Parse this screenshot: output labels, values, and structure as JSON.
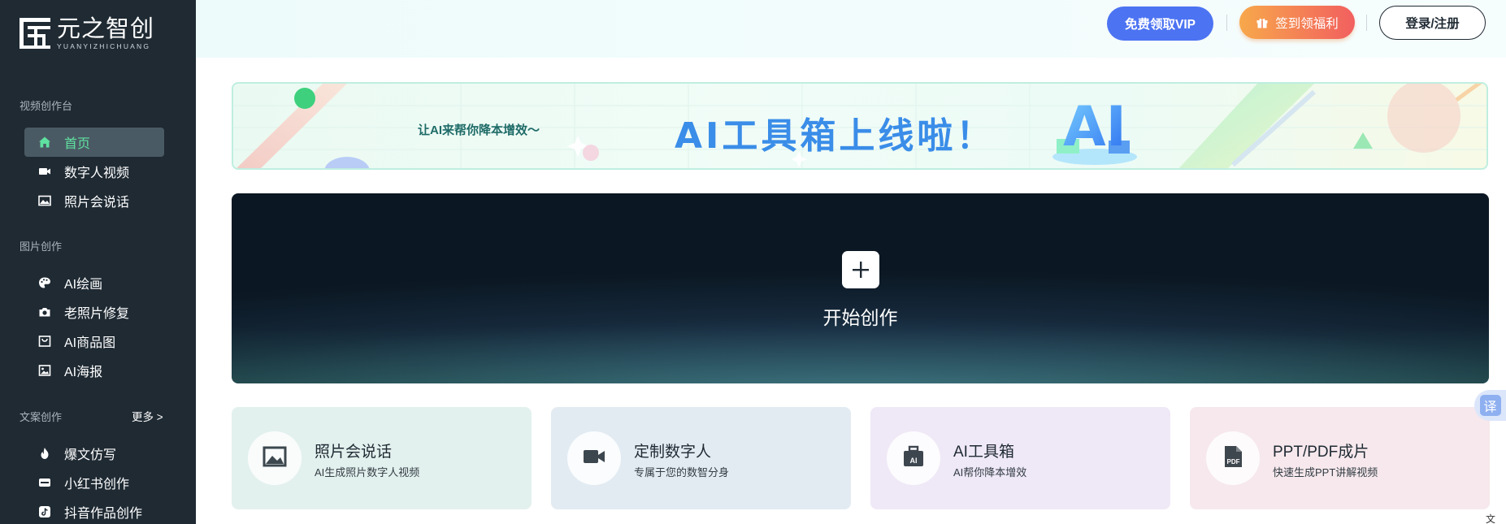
{
  "brand": {
    "name_cn": "元之智创",
    "name_en": "YUANYIZHICHUANG"
  },
  "sidebar": {
    "sections": [
      {
        "title": "视频创作台",
        "items": [
          {
            "label": "首页",
            "icon": "home-icon",
            "active": true
          },
          {
            "label": "数字人视频",
            "icon": "video-camera-icon"
          },
          {
            "label": "照片会说话",
            "icon": "image-icon"
          }
        ]
      },
      {
        "title": "图片创作",
        "items": [
          {
            "label": "AI绘画",
            "icon": "palette-icon"
          },
          {
            "label": "老照片修复",
            "icon": "camera-icon"
          },
          {
            "label": "AI商品图",
            "icon": "shopping-bag-icon"
          },
          {
            "label": "AI海报",
            "icon": "picture-icon"
          }
        ]
      },
      {
        "title": "文案创作",
        "more": "更多 >",
        "items": [
          {
            "label": "爆文仿写",
            "icon": "fire-icon"
          },
          {
            "label": "小红书创作",
            "icon": "xiaohongshu-icon"
          },
          {
            "label": "抖音作品创作",
            "icon": "tiktok-icon"
          }
        ]
      }
    ]
  },
  "header": {
    "vip_button": "免费领取VIP",
    "signin_button": "签到领福利",
    "login_button": "登录/注册"
  },
  "banner": {
    "subtitle": "让AI来帮你降本增效～",
    "title": "AI工具箱上线啦！",
    "badge": "AI"
  },
  "hero": {
    "label": "开始创作"
  },
  "cards": [
    {
      "title": "照片会说话",
      "desc": "AI生成照片数字人视频",
      "icon": "image-icon",
      "bg": "#e3f1ee"
    },
    {
      "title": "定制数字人",
      "desc": "专属于您的数智分身",
      "icon": "video-camera-icon",
      "bg": "#e3ebf2"
    },
    {
      "title": "AI工具箱",
      "desc": "AI帮你降本增效",
      "icon": "ai-toolbox-icon",
      "bg": "#efe8f6",
      "badge": "AI"
    },
    {
      "title": "PPT/PDF成片",
      "desc": "快速生成PPT讲解视频",
      "icon": "pdf-file-icon",
      "bg": "#f6e8ec",
      "badge": "PDF"
    }
  ],
  "translate_button": "译",
  "corner_glyph": "文"
}
